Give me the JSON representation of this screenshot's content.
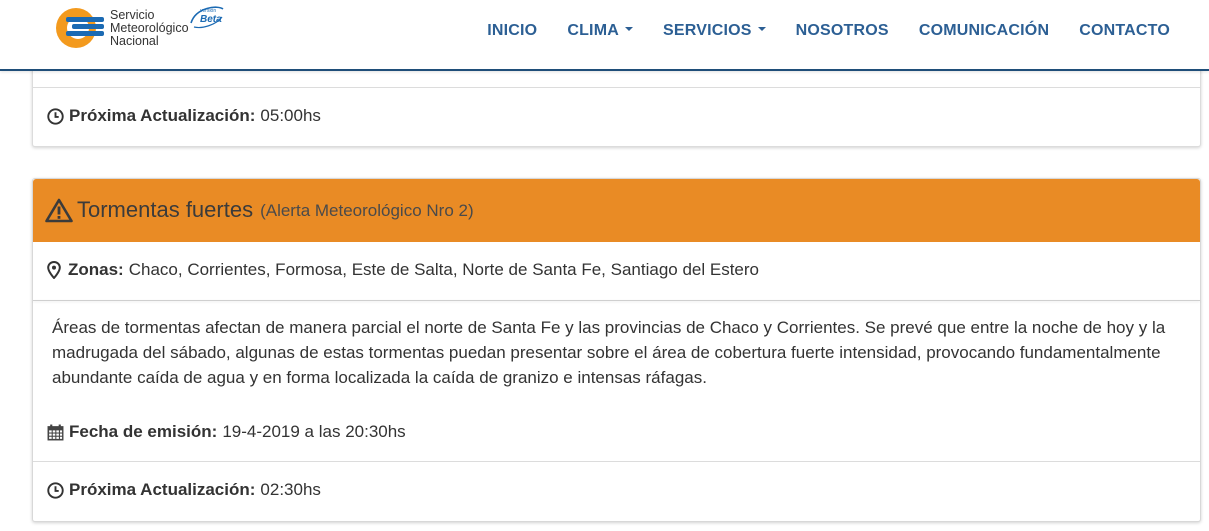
{
  "header": {
    "logo_lines": [
      "Servicio",
      "Meteorológico",
      "Nacional"
    ],
    "beta_small": "versión",
    "beta_label": "Beta",
    "nav": [
      {
        "label": "INICIO",
        "dropdown": false
      },
      {
        "label": "CLIMA",
        "dropdown": true
      },
      {
        "label": "SERVICIOS",
        "dropdown": true
      },
      {
        "label": "NOSOTROS",
        "dropdown": false
      },
      {
        "label": "COMUNICACIÓN",
        "dropdown": false
      },
      {
        "label": "CONTACTO",
        "dropdown": false
      }
    ]
  },
  "panel_prev": {
    "next_update_label": "Próxima Actualización:",
    "next_update_value": "05:00hs"
  },
  "alert": {
    "title": "Tormentas fuertes",
    "subtitle": "(Alerta Meteorológico Nro 2)",
    "zones_label": "Zonas:",
    "zones_value": "Chaco, Corrientes, Formosa, Este de Salta, Norte de Santa Fe, Santiago del Estero",
    "description": "Áreas de tormentas afectan de manera parcial el norte de Santa Fe y las provincias de Chaco y Corrientes. Se prevé que entre la noche de hoy y la madrugada del sábado, algunas de estas tormentas puedan presentar sobre el área de cobertura fuerte intensidad, provocando fundamentalmente abundante caída de agua y en forma localizada la caída de granizo e intensas ráfagas.",
    "issued_label": "Fecha de emisión:",
    "issued_value": "19-4-2019 a las 20:30hs",
    "next_update_label": "Próxima Actualización:",
    "next_update_value": "02:30hs"
  },
  "icons": {
    "clock": "clock-icon",
    "warning": "warning-triangle-icon",
    "marker": "map-marker-icon",
    "calendar": "calendar-icon"
  },
  "colors": {
    "nav_text": "#2c5f94",
    "alert_orange": "#e98b25",
    "logo_orange": "#f39a1e",
    "logo_blue": "#1b6ab3"
  }
}
